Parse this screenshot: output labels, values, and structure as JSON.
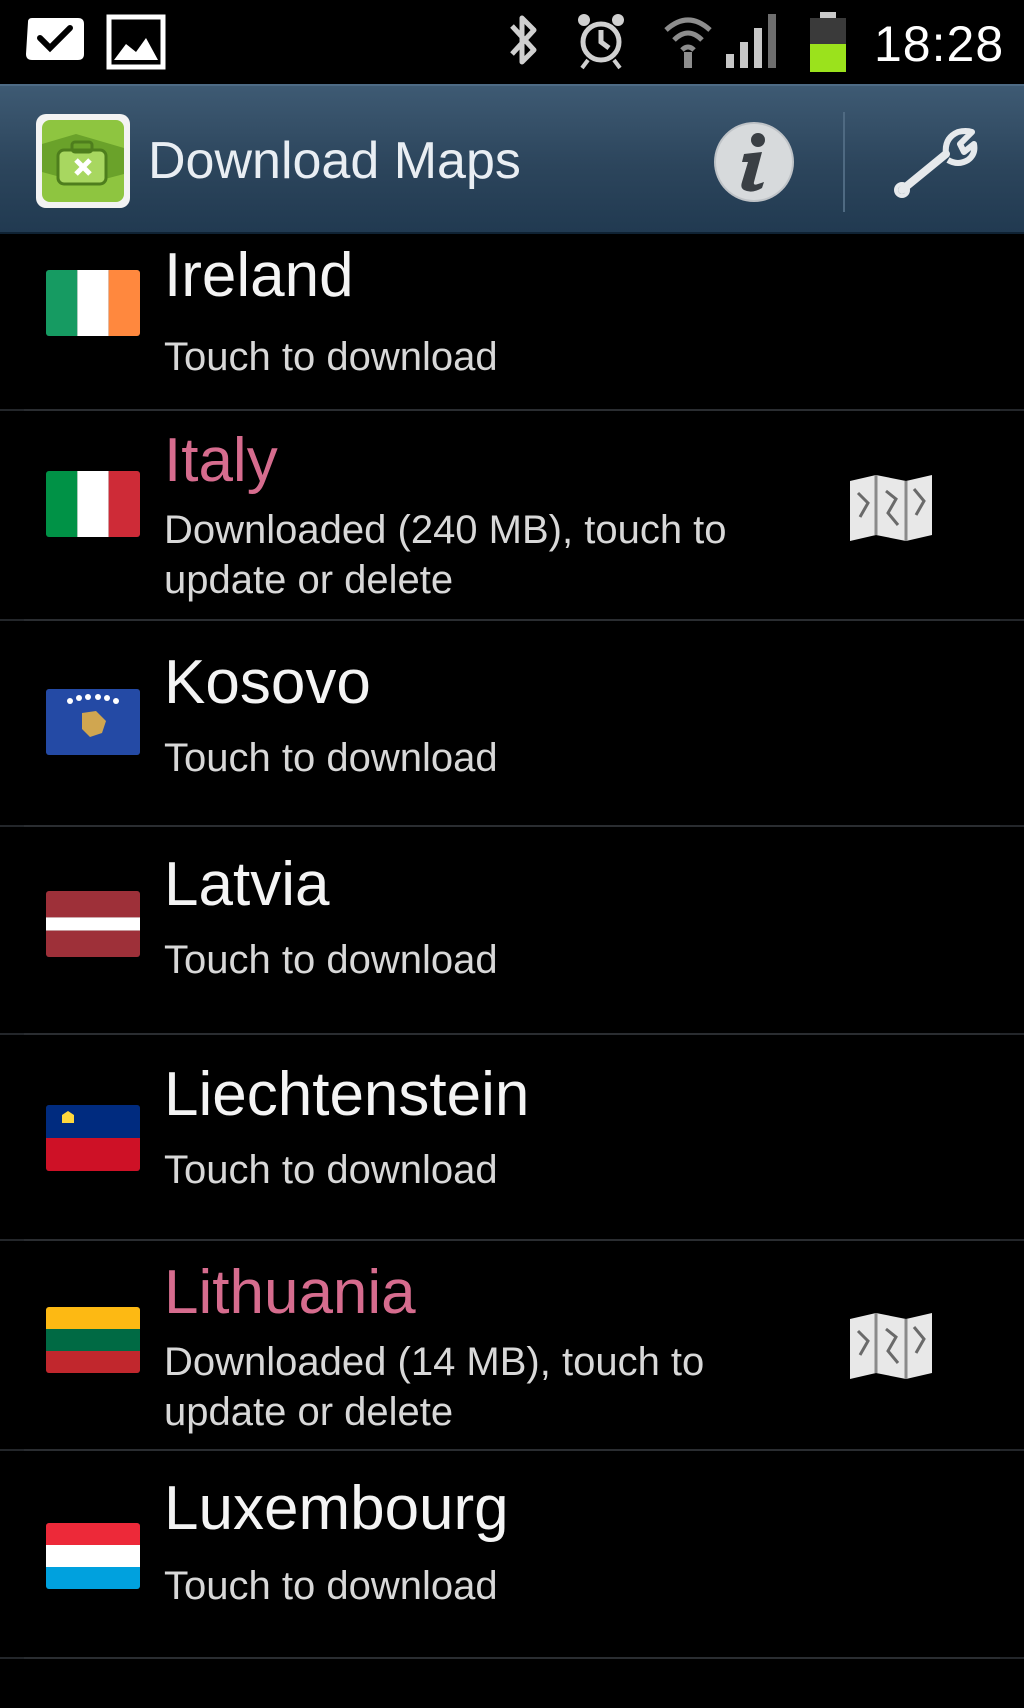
{
  "status_bar": {
    "time": "18:28",
    "icons": [
      "notification-check-icon",
      "gallery-icon",
      "bluetooth-icon",
      "alarm-icon",
      "wifi-icon",
      "signal-icon",
      "battery-icon"
    ],
    "battery_color": "#9be21c"
  },
  "action_bar": {
    "title": "Download Maps",
    "icons": [
      "app-map-icon",
      "info-icon",
      "wrench-icon"
    ],
    "background": "#2c455c"
  },
  "countries": [
    {
      "name": "Ireland",
      "status": "Touch to download",
      "downloaded": false,
      "flag": "ireland-flag"
    },
    {
      "name": "Italy",
      "status": "Downloaded (240 MB), touch to update or delete",
      "downloaded": true,
      "flag": "italy-flag"
    },
    {
      "name": "Kosovo",
      "status": "Touch to download",
      "downloaded": false,
      "flag": "kosovo-flag"
    },
    {
      "name": "Latvia",
      "status": "Touch to download",
      "downloaded": false,
      "flag": "latvia-flag"
    },
    {
      "name": "Liechtenstein",
      "status": "Touch to download",
      "downloaded": false,
      "flag": "liechtenstein-flag"
    },
    {
      "name": "Lithuania",
      "status": "Downloaded (14 MB), touch to update or delete",
      "downloaded": true,
      "flag": "lithuania-flag"
    },
    {
      "name": "Luxembourg",
      "status": "Touch to download",
      "downloaded": false,
      "flag": "luxembourg-flag"
    }
  ],
  "colors": {
    "downloaded_name": "#d66c8e",
    "normal_name": "#f4f4f4",
    "subtext": "#d8d8d8"
  }
}
